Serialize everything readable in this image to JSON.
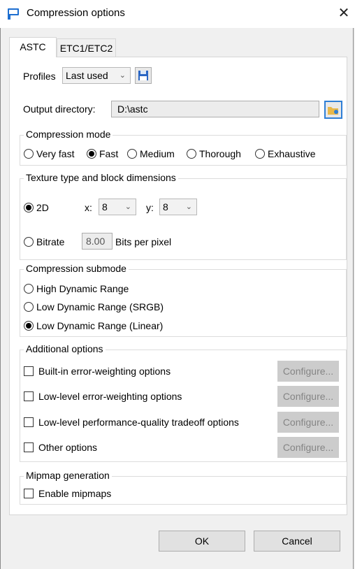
{
  "window": {
    "title": "Compression options",
    "close": "✕"
  },
  "tabs": [
    {
      "label": "ASTC",
      "active": true
    },
    {
      "label": "ETC1/ETC2",
      "active": false
    }
  ],
  "profiles": {
    "label": "Profiles",
    "value": "Last used"
  },
  "output": {
    "label": "Output directory:",
    "value": "D:\\astc"
  },
  "compression_mode": {
    "title": "Compression mode",
    "options": [
      "Very fast",
      "Fast",
      "Medium",
      "Thorough",
      "Exhaustive"
    ],
    "selected": "Fast"
  },
  "texture": {
    "title": "Texture type and block dimensions",
    "twod_label": "2D",
    "x_label": "x:",
    "x_value": "8",
    "y_label": "y:",
    "y_value": "8",
    "bitrate_label": "Bitrate",
    "bitrate_value": "8.00",
    "bitrate_unit": "Bits per pixel",
    "selected": "2D"
  },
  "submode": {
    "title": "Compression submode",
    "options": [
      "High Dynamic Range",
      "Low Dynamic Range (SRGB)",
      "Low Dynamic Range (Linear)"
    ],
    "selected": "Low Dynamic Range (Linear)"
  },
  "additional": {
    "title": "Additional options",
    "items": [
      {
        "label": "Built-in error-weighting options",
        "button": "Configure..."
      },
      {
        "label": "Low-level error-weighting options",
        "button": "Configure..."
      },
      {
        "label": "Low-level performance-quality tradeoff options",
        "button": "Configure..."
      },
      {
        "label": "Other options",
        "button": "Configure..."
      }
    ]
  },
  "mipmap": {
    "title": "Mipmap generation",
    "label": "Enable mipmaps"
  },
  "footer": {
    "ok": "OK",
    "cancel": "Cancel"
  },
  "colors": {
    "accent": "#2f7fd6",
    "disabled_button": "#cccccc"
  }
}
